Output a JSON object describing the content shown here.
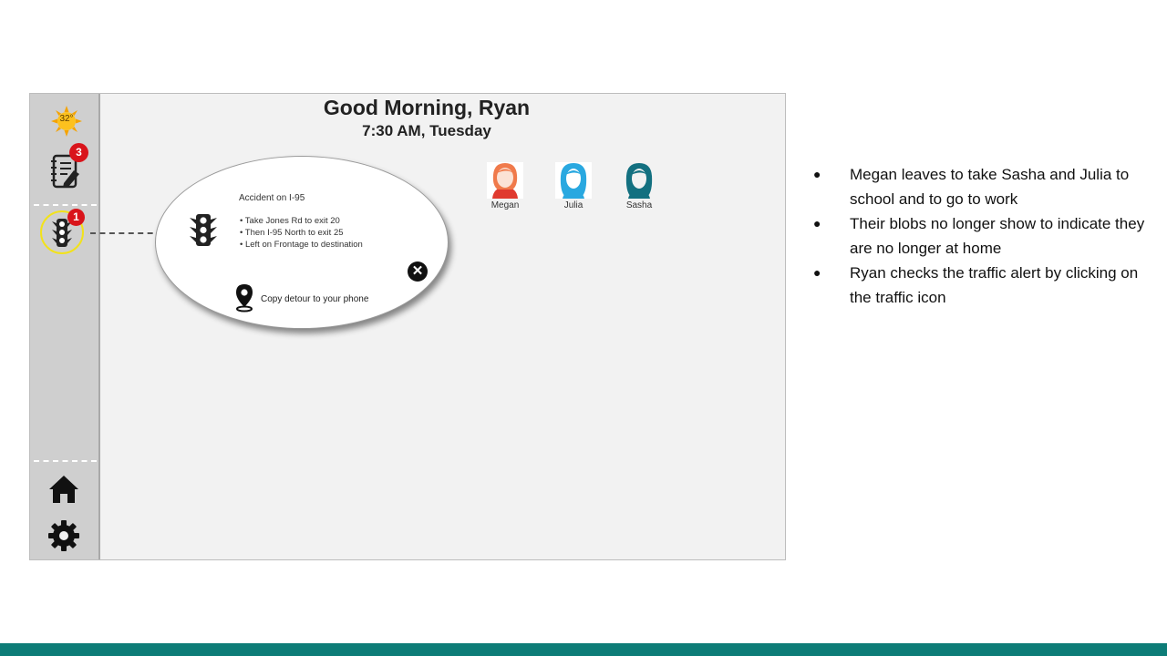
{
  "header": {
    "greeting": "Good Morning, Ryan",
    "datetime": "7:30 AM, Tuesday"
  },
  "sidebar": {
    "weather": {
      "temperature": "32°",
      "icon": "sun-icon"
    },
    "tasks": {
      "icon": "notebook-icon",
      "badge_count": "3"
    },
    "traffic": {
      "icon": "traffic-light-icon",
      "badge_count": "1",
      "highlighted": true
    },
    "home": {
      "icon": "home-icon"
    },
    "settings": {
      "icon": "gear-icon"
    }
  },
  "family_members": [
    {
      "name": "Megan",
      "color": "#f07a4b"
    },
    {
      "name": "Julia",
      "color": "#29a8e0"
    },
    {
      "name": "Sasha",
      "color": "#137080"
    }
  ],
  "traffic_alert": {
    "title": "Accident on I-95",
    "steps": [
      "• Take Jones Rd to exit 20",
      "• Then I-95 North to exit 25",
      "• Left on Frontage to destination"
    ],
    "copy_label": "Copy detour to your phone",
    "close_icon": "close-icon",
    "pin_icon": "location-pin-icon"
  },
  "notes": [
    "Megan leaves to take Sasha and Julia to school and to go to work",
    "Their blobs no longer show to indicate they are no longer at home",
    "Ryan checks the traffic alert by clicking on the traffic icon"
  ],
  "colors": {
    "accent_bar": "#0d7c77",
    "badge": "#d9141b",
    "highlight_ring": "#f2e21b"
  }
}
